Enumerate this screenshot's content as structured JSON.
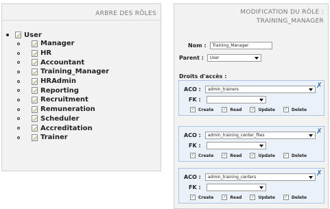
{
  "left_panel": {
    "title": "ARBRE DES RÔLES",
    "root": {
      "label": "User"
    },
    "children": [
      "Manager",
      "HR",
      "Accountant",
      "Training_Manager",
      "HRAdmin",
      "Reporting",
      "Recruitment",
      "Remuneration",
      "Scheduler",
      "Accreditation",
      "Trainer"
    ]
  },
  "right_panel": {
    "title_line1": "MODIFICATION DU RÔLE :",
    "title_line2": "TRAINING_MANAGER",
    "nom_label": "Nom :",
    "nom_value": "Training_Manager",
    "parent_label": "Parent :",
    "parent_value": "User",
    "droits_label": "Droits d'accès :",
    "aco_label": "ACO :",
    "fk_label": "FK :",
    "check_labels": [
      "Create",
      "Read",
      "Update",
      "Delete"
    ],
    "aco_entries": [
      {
        "aco": "admin_trainers",
        "fk": "",
        "checks": [
          true,
          true,
          true,
          true
        ]
      },
      {
        "aco": "admin_training_center_files",
        "fk": "",
        "checks": [
          true,
          true,
          true,
          true
        ]
      },
      {
        "aco": "admin_training_centers",
        "fk": "",
        "checks": [
          true,
          true,
          true,
          true
        ]
      }
    ],
    "remove_icon": "✗",
    "checkmark": "✓"
  }
}
